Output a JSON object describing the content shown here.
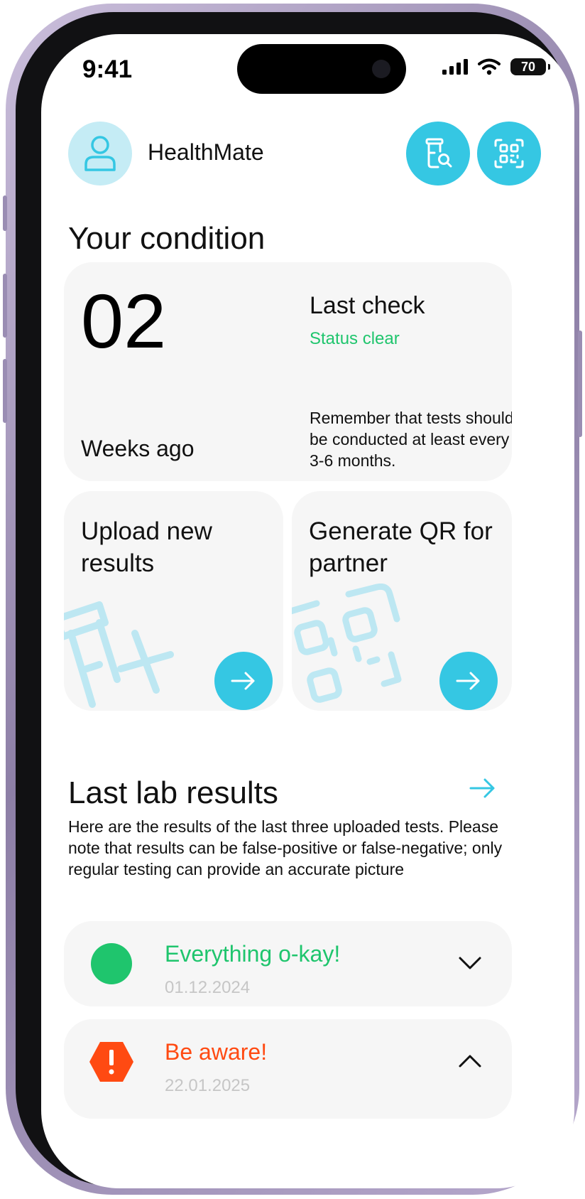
{
  "status_bar": {
    "time": "9:41",
    "battery": "70"
  },
  "header": {
    "app_name": "HealthMate"
  },
  "condition": {
    "section_title": "Your condition",
    "weeks_count": "02",
    "weeks_label": "Weeks ago",
    "last_check_title": "Last check",
    "status_text": "Status clear",
    "reminder": "Remember that tests should be conducted at least every 3-6 months."
  },
  "actions": {
    "upload_title": "Upload new results",
    "qr_title": "Generate QR for partner"
  },
  "lab_results": {
    "section_title": "Last lab results",
    "description": "Here are the results of the last three uploaded tests. Please note that results can be false-positive or false-negative; only regular testing can provide an accurate picture",
    "items": [
      {
        "title": "Everything o-kay!",
        "date": "01.12.2024"
      },
      {
        "title": "Be aware!",
        "date": "22.01.2025"
      }
    ]
  },
  "colors": {
    "accent": "#35c7e3",
    "success": "#1fc56d",
    "warning": "#ff4a12",
    "card_bg": "#f6f6f6"
  },
  "icons": [
    "signal-icon",
    "wifi-icon",
    "battery-icon",
    "user-icon",
    "test-search-icon",
    "qr-code-icon",
    "arrow-right-icon",
    "chevron-down-icon",
    "chevron-up-icon",
    "warning-icon"
  ]
}
